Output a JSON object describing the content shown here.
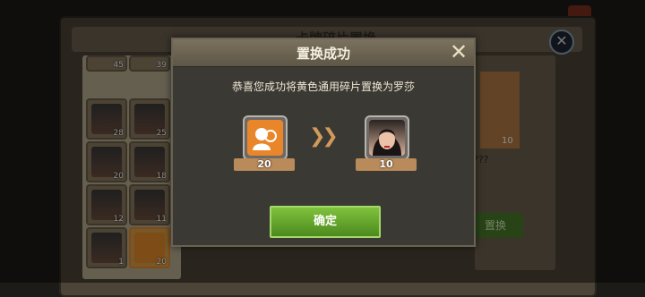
{
  "background": {
    "title": "卡牌碎片置换",
    "inventory": [
      {
        "count": "45"
      },
      {
        "count": "39"
      },
      {
        "count": "28"
      },
      {
        "count": "25"
      },
      {
        "count": "20"
      },
      {
        "count": "18"
      },
      {
        "count": "12"
      },
      {
        "count": "11"
      },
      {
        "count": "1"
      },
      {
        "count": "20"
      }
    ],
    "right_count": "10",
    "right_name": "???",
    "right_button": "置换"
  },
  "dialog": {
    "title": "置换成功",
    "message": "恭喜您成功将黄色通用碎片置换为罗莎",
    "source": {
      "icon": "orange-universal-fragment-icon",
      "count": "20"
    },
    "target": {
      "icon": "rosa-portrait-icon",
      "count": "10"
    },
    "arrow_icon": "double-chevron-right-icon",
    "confirm_label": "确定",
    "close_icon": "close-icon"
  }
}
